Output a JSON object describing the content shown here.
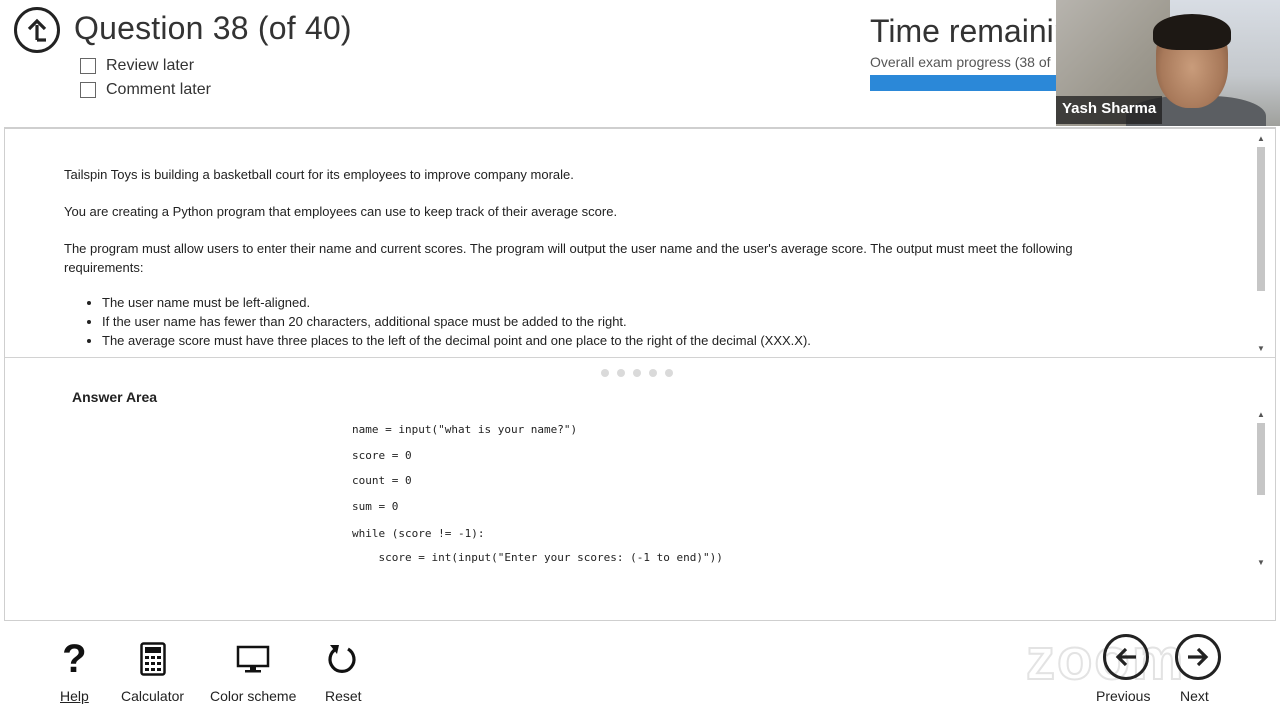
{
  "header": {
    "question_title": "Question 38 (of 40)",
    "review_later": "Review later",
    "comment_later": "Comment later",
    "time_title": "Time remainin",
    "progress_label": "Overall exam progress (38 of",
    "progress_fraction": 0.93
  },
  "webcam": {
    "participant_name": "Yash Sharma"
  },
  "question": {
    "paragraphs": [
      "Tailspin Toys is building a basketball court for its employees to improve company morale.",
      "You are creating a Python program that employees can use to keep track of their average score.",
      "The program must allow users to enter their name and current scores. The program will output the user name and the user's average score. The output must meet the following requirements:"
    ],
    "requirements": [
      "The user name must be left-aligned.",
      "If the user name has fewer than 20 characters, additional space must be added to the right.",
      "The average score must have three places to the left of the decimal point and one place to the right of the decimal (XXX.X)."
    ]
  },
  "answer": {
    "title": "Answer Area",
    "code_lines": [
      "name = input(\"what is your name?\")",
      "score = 0",
      "count = 0",
      "sum = 0",
      "while (score != -1):",
      "    score = int(input(\"Enter your scores: (-1 to end)\"))"
    ]
  },
  "toolbar": {
    "help": "Help",
    "calculator": "Calculator",
    "color_scheme": "Color scheme",
    "reset": "Reset",
    "previous": "Previous",
    "next": "Next"
  },
  "icons": {
    "back": "back-arrow-icon",
    "help": "question-mark-icon",
    "calculator": "calculator-icon",
    "color_scheme": "monitor-icon",
    "reset": "reset-icon",
    "previous": "arrow-left-icon",
    "next": "arrow-right-icon"
  },
  "colors": {
    "progress_fill": "#2b88d8",
    "text": "#222222"
  }
}
